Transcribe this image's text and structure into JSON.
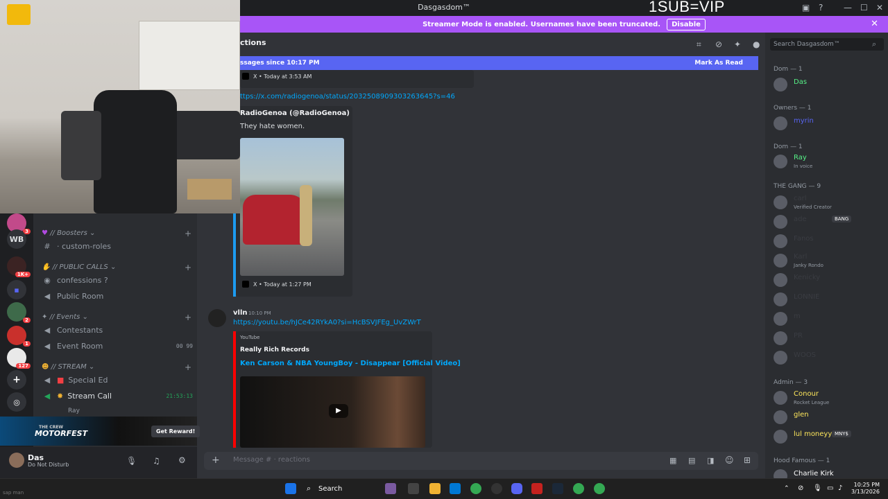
{
  "window": {
    "title": "Dasgasdom™",
    "overlay_text": "1SUB=VIP"
  },
  "streamer_bar": {
    "message": "Streamer Mode is enabled. Usernames have been truncated.",
    "disable_label": "Disable"
  },
  "chat": {
    "channel_title": "ctions",
    "new_messages_text": "ssages since 10:17 PM",
    "mark_as_read": "Mark As Read",
    "embed1_source": "X • Today at 3:53 AM",
    "post_link": "ttps://x.com/radiogenoa/status/2032508909303263645?s=46",
    "tweet_author": "RadioGenoa (@RadioGenoa)",
    "tweet_text": "They hate women.",
    "embed2_source": "X • Today at 1:27 PM",
    "msg2_author": "vlln",
    "msg2_time": "10:10 PM",
    "msg2_link": "https://youtu.be/hJCe42RYkA0?si=HcBSVJFEg_UvZWrT",
    "yt_provider": "YouTube",
    "yt_channel": "Really Rich Records",
    "yt_title": "Ken Carson & NBA YoungBoy - Disappear [Official Video]",
    "composer_placeholder": "Message # · reactions"
  },
  "sidebar": {
    "rail_label_wb": "WB",
    "badges": [
      "3",
      "1K+",
      "2",
      "1",
      "127"
    ],
    "categories": [
      {
        "label": "// Boosters",
        "channels": [
          {
            "label": "· custom-roles",
            "icon": "hash"
          }
        ]
      },
      {
        "label": "// PUBLIC CALLS",
        "channels": [
          {
            "label": "confessions ?",
            "icon": "stage"
          },
          {
            "label": "Public Room",
            "icon": "voice"
          }
        ]
      },
      {
        "label": "// Events",
        "channels": [
          {
            "label": "Contestants",
            "icon": "voice"
          },
          {
            "label": "Event Room",
            "icon": "voice",
            "meta": "00  99"
          }
        ]
      },
      {
        "label": "// STREAM",
        "channels": [
          {
            "label": "Special Ed",
            "icon": "voice"
          },
          {
            "label": "Stream Call",
            "icon": "voice",
            "meta": "21:53:13"
          }
        ]
      }
    ],
    "voice_user": "Ray"
  },
  "promo": {
    "title": "MOTORFEST",
    "subtitle": "THE CREW",
    "button": "Get Reward!"
  },
  "user": {
    "name": "Das",
    "status": "Do Not Disturb"
  },
  "members": {
    "search_placeholder": "Search Dasgasdom™",
    "groups": [
      {
        "header": "Dom — 1",
        "items": [
          {
            "name": "Das",
            "color": "#57f287"
          }
        ]
      },
      {
        "header": "Owners — 1",
        "items": [
          {
            "name": "myrin",
            "color": "#5865f2"
          }
        ]
      },
      {
        "header": "Dom — 1",
        "items": [
          {
            "name": "Ray",
            "color": "#57f287",
            "sub": "In voice"
          }
        ]
      },
      {
        "header": "THE GANG — 9",
        "items": [
          {
            "name": "carl",
            "color": "#3a3c42",
            "sub": "Verified Creator"
          },
          {
            "name": "ade",
            "color": "#3a3c42",
            "tag": "BANG"
          },
          {
            "name": "Fanos",
            "color": "#3a3c42"
          },
          {
            "name": "Karl",
            "color": "#3a3c42",
            "sub": "Janky Rondo"
          },
          {
            "name": "Kenicky",
            "color": "#3a3c42"
          },
          {
            "name": "LONNIE",
            "color": "#3a3c42"
          },
          {
            "name": "m",
            "color": "#3a3c42"
          },
          {
            "name": "PR",
            "color": "#3a3c42"
          },
          {
            "name": "WOOS",
            "color": "#3a3c42"
          }
        ]
      },
      {
        "header": "Admin — 3",
        "items": [
          {
            "name": "Conour",
            "color": "#fee75c",
            "sub": "Rocket League"
          },
          {
            "name": "glen",
            "color": "#fee75c"
          },
          {
            "name": "lul moneyy",
            "color": "#fee75c",
            "tag": "MNY$"
          }
        ]
      },
      {
        "header": "Hood Famous — 1",
        "items": [
          {
            "name": "Charlie Kirk",
            "color": "#ffffff"
          }
        ]
      }
    ]
  },
  "taskbar": {
    "search_label": "Search",
    "time": "10:25 PM",
    "date": "3/13/2026",
    "corner_text": "sap man"
  }
}
